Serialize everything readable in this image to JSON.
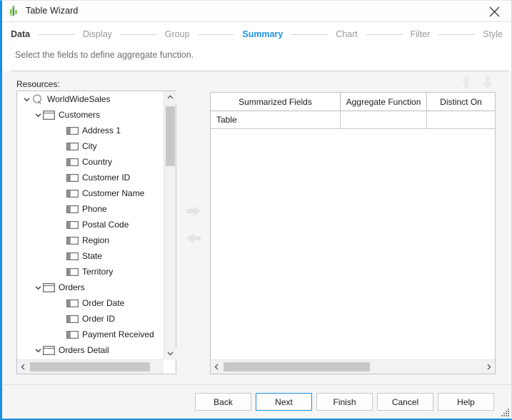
{
  "window": {
    "title": "Table Wizard",
    "icon": "chart-bars-icon",
    "close_icon": "close-icon",
    "accent_color": "#1b93e8"
  },
  "steps": [
    {
      "label": "Data",
      "state": "done"
    },
    {
      "label": "Display",
      "state": "pending"
    },
    {
      "label": "Group",
      "state": "pending"
    },
    {
      "label": "Summary",
      "state": "current"
    },
    {
      "label": "Chart",
      "state": "pending"
    },
    {
      "label": "Filter",
      "state": "pending"
    },
    {
      "label": "Style",
      "state": "pending"
    }
  ],
  "subtitle": "Select the fields to define aggregate function.",
  "resources": {
    "label": "Resources:",
    "tree": [
      {
        "label": "WorldWideSales",
        "level": 0,
        "icon": "query-icon",
        "expanded": true
      },
      {
        "label": "Customers",
        "level": 1,
        "icon": "table-icon",
        "expanded": true
      },
      {
        "label": "Address 1",
        "level": 2,
        "icon": "column-icon",
        "expanded": null
      },
      {
        "label": "City",
        "level": 2,
        "icon": "column-icon",
        "expanded": null
      },
      {
        "label": "Country",
        "level": 2,
        "icon": "column-icon",
        "expanded": null
      },
      {
        "label": "Customer ID",
        "level": 2,
        "icon": "column-icon",
        "expanded": null
      },
      {
        "label": "Customer Name",
        "level": 2,
        "icon": "column-icon",
        "expanded": null
      },
      {
        "label": "Phone",
        "level": 2,
        "icon": "column-icon",
        "expanded": null
      },
      {
        "label": "Postal Code",
        "level": 2,
        "icon": "column-icon",
        "expanded": null
      },
      {
        "label": "Region",
        "level": 2,
        "icon": "column-icon",
        "expanded": null
      },
      {
        "label": "State",
        "level": 2,
        "icon": "column-icon",
        "expanded": null
      },
      {
        "label": "Territory",
        "level": 2,
        "icon": "column-icon",
        "expanded": null
      },
      {
        "label": "Orders",
        "level": 1,
        "icon": "table-icon",
        "expanded": true
      },
      {
        "label": "Order Date",
        "level": 2,
        "icon": "column-icon",
        "expanded": null
      },
      {
        "label": "Order ID",
        "level": 2,
        "icon": "column-icon",
        "expanded": null
      },
      {
        "label": "Payment Received",
        "level": 2,
        "icon": "column-icon",
        "expanded": null
      },
      {
        "label": "Orders Detail",
        "level": 1,
        "icon": "table-icon",
        "expanded": true
      }
    ]
  },
  "transfer": {
    "add_icon": "arrow-right-icon",
    "remove_icon": "arrow-left-icon"
  },
  "sort": {
    "up_icon": "arrow-up-icon",
    "down_icon": "arrow-down-icon"
  },
  "summary_grid": {
    "columns": [
      "Summarized Fields",
      "Aggregate Function",
      "Distinct On"
    ],
    "rows": [
      [
        "Table",
        "",
        ""
      ]
    ]
  },
  "footer": {
    "buttons": [
      {
        "label": "Back",
        "primary": false
      },
      {
        "label": "Next",
        "primary": true
      },
      {
        "label": "Finish",
        "primary": false
      },
      {
        "label": "Cancel",
        "primary": false
      },
      {
        "label": "Help",
        "primary": false
      }
    ]
  }
}
